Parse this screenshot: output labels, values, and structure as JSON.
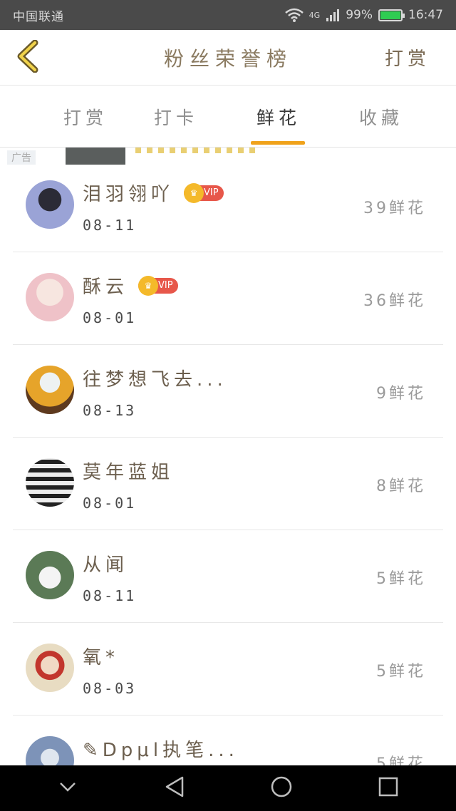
{
  "status_bar": {
    "carrier": "中国联通",
    "network": "4G",
    "battery_percent": "99%",
    "time": "16:47",
    "battery_color": "#2fcc52"
  },
  "header": {
    "title": "粉丝荣誉榜",
    "action_label": "打赏",
    "back_icon": "chevron-left-icon",
    "accent": "#f0a21a"
  },
  "tabs": [
    {
      "label": "打赏",
      "active": false
    },
    {
      "label": "打卡",
      "active": false
    },
    {
      "label": "鲜花",
      "active": true
    },
    {
      "label": "收藏",
      "active": false
    }
  ],
  "ad": {
    "label": "广告"
  },
  "fans": [
    {
      "name": "泪羽翎吖",
      "vip": true,
      "vip_label": "VIP",
      "date": "08-11",
      "count": "39鲜花",
      "avatar_color": "#8a93c9"
    },
    {
      "name": "酥云",
      "vip": true,
      "vip_label": "VIP",
      "date": "08-01",
      "count": "36鲜花",
      "avatar_color": "#f3d4d6"
    },
    {
      "name": "往梦想飞去...",
      "vip": false,
      "date": "08-13",
      "count": "9鲜花",
      "avatar_color": "#b98a3a"
    },
    {
      "name": "莫年蓝姐",
      "vip": false,
      "date": "08-01",
      "count": "8鲜花",
      "avatar_color": "#3b3b4a"
    },
    {
      "name": "从闻",
      "vip": false,
      "date": "08-11",
      "count": "5鲜花",
      "avatar_color": "#6e8a66"
    },
    {
      "name": "氧*",
      "vip": false,
      "date": "08-03",
      "count": "5鲜花",
      "avatar_color": "#c98c6e"
    },
    {
      "name": "✎Dpμl执笔...",
      "vip": false,
      "date": "",
      "count": "5鲜花",
      "avatar_color": "#7d93b8"
    }
  ],
  "nav_bar": {
    "back": "triangle-back-icon",
    "home": "circle-home-icon",
    "recents": "square-recents-icon",
    "hide": "chevron-down-icon"
  }
}
